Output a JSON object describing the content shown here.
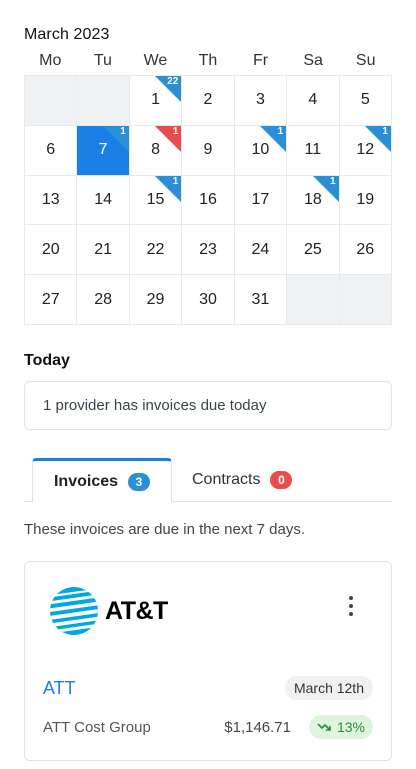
{
  "calendar": {
    "month_label": "March 2023",
    "weekdays": [
      "Mo",
      "Tu",
      "We",
      "Th",
      "Fr",
      "Sa",
      "Su"
    ],
    "cells": [
      {
        "day": ""
      },
      {
        "day": ""
      },
      {
        "day": "1",
        "badge": "22",
        "badge_color": "blue"
      },
      {
        "day": "2"
      },
      {
        "day": "3"
      },
      {
        "day": "4"
      },
      {
        "day": "5"
      },
      {
        "day": "6"
      },
      {
        "day": "7",
        "selected": true,
        "badge": "1",
        "badge_color": "blue"
      },
      {
        "day": "8",
        "badge": "1",
        "badge_color": "red"
      },
      {
        "day": "9"
      },
      {
        "day": "10",
        "badge": "1",
        "badge_color": "blue"
      },
      {
        "day": "11"
      },
      {
        "day": "12",
        "badge": "1",
        "badge_color": "blue"
      },
      {
        "day": "13"
      },
      {
        "day": "14"
      },
      {
        "day": "15",
        "badge": "1",
        "badge_color": "blue"
      },
      {
        "day": "16"
      },
      {
        "day": "17"
      },
      {
        "day": "18",
        "badge": "1",
        "badge_color": "blue"
      },
      {
        "day": "19"
      },
      {
        "day": "20"
      },
      {
        "day": "21"
      },
      {
        "day": "22"
      },
      {
        "day": "23"
      },
      {
        "day": "24"
      },
      {
        "day": "25"
      },
      {
        "day": "26"
      },
      {
        "day": "27"
      },
      {
        "day": "28"
      },
      {
        "day": "29"
      },
      {
        "day": "30"
      },
      {
        "day": "31"
      },
      {
        "day": ""
      },
      {
        "day": ""
      }
    ]
  },
  "today": {
    "label": "Today",
    "message": "1 provider has invoices due today"
  },
  "tabs": {
    "invoices_label": "Invoices",
    "invoices_count": "3",
    "contracts_label": "Contracts",
    "contracts_count": "0"
  },
  "due_note": "These invoices are due in the next 7 days.",
  "invoice_card": {
    "logo_text": "AT&T",
    "provider": "ATT",
    "due_date": "March 12th",
    "group": "ATT Cost Group",
    "amount": "$1,146.71",
    "trend": "13%",
    "trend_direction": "down"
  },
  "colors": {
    "accent": "#1a80e6",
    "badge_blue": "#2a8fd6",
    "badge_red": "#e84c4c",
    "trend_bg": "#ddf5dd",
    "trend_text": "#2f8a3e"
  }
}
